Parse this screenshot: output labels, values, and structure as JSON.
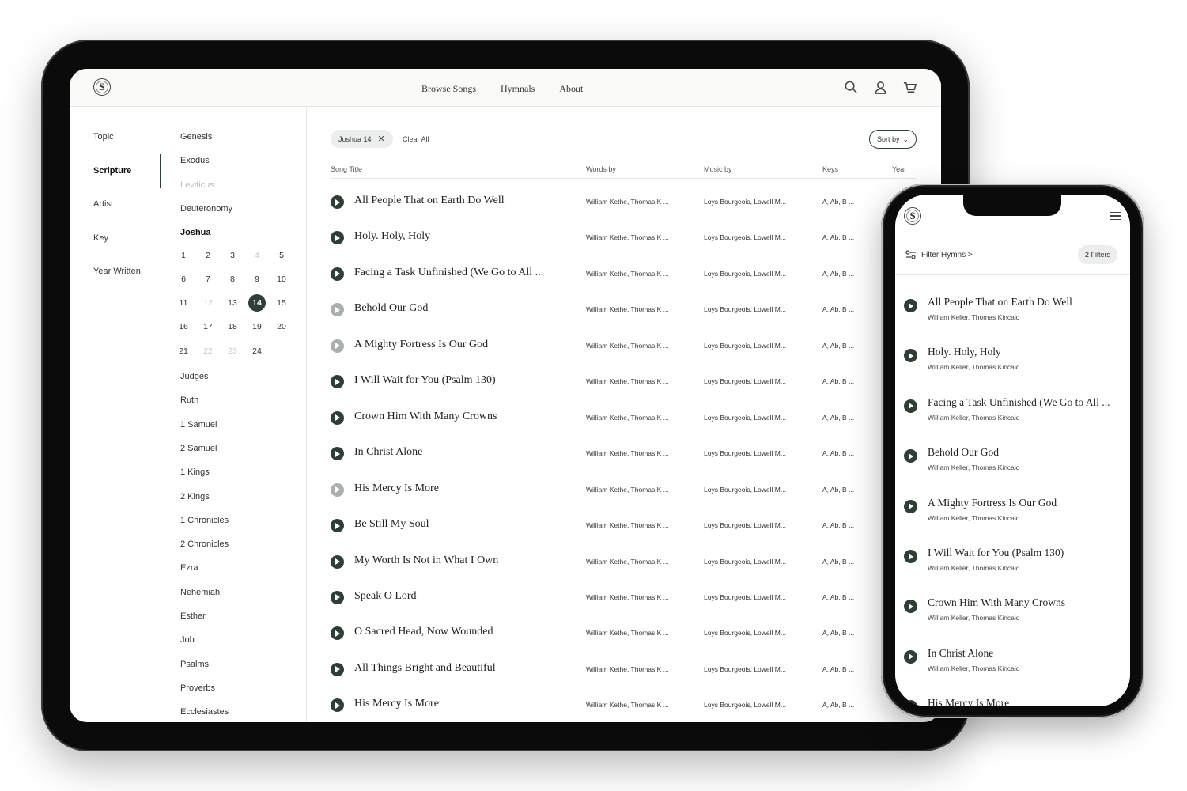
{
  "nav": {
    "browse": "Browse Songs",
    "hymnals": "Hymnals",
    "about": "About",
    "logo": "S"
  },
  "icons": [
    "search-icon",
    "user-icon",
    "cart-icon"
  ],
  "categories": [
    "Topic",
    "Scripture",
    "Artist",
    "Key",
    "Year Written"
  ],
  "active_category": "Scripture",
  "books_before": [
    "Genesis",
    "Exodus",
    "Leviticus",
    "Deuteronomy",
    "Joshua"
  ],
  "chapters": [
    "1",
    "2",
    "3",
    "4",
    "5",
    "6",
    "7",
    "8",
    "9",
    "10",
    "11",
    "12",
    "13",
    "14",
    "15",
    "16",
    "17",
    "18",
    "19",
    "20",
    "21",
    "22",
    "23",
    "24"
  ],
  "dim_chapters": [
    "4",
    "12",
    "22",
    "23"
  ],
  "selected_chapter": "14",
  "books_after": [
    "Judges",
    "Ruth",
    "1 Samuel",
    "2 Samuel",
    "1 Kings",
    "2 Kings",
    "1 Chronicles",
    "2 Chronicles",
    "Ezra",
    "Nehemiah",
    "Esther",
    "Job",
    "Psalms",
    "Proverbs",
    "Ecclesiastes"
  ],
  "filter": {
    "chip": "Joshua 14",
    "clear": "Clear All",
    "sort": "Sort by"
  },
  "columns": {
    "title": "Song Title",
    "words": "Words by",
    "music": "Music by",
    "keys": "Keys",
    "year": "Year"
  },
  "songs": [
    {
      "title": "All People That on Earth Do Well",
      "dim": false
    },
    {
      "title": "Holy. Holy, Holy",
      "dim": false
    },
    {
      "title": "Facing a Task Unfinished (We Go to All ...",
      "dim": false
    },
    {
      "title": "Behold Our God",
      "dim": true
    },
    {
      "title": "A Mighty Fortress Is Our God",
      "dim": true
    },
    {
      "title": "I Will Wait for You (Psalm 130)",
      "dim": false
    },
    {
      "title": "Crown Him With Many Crowns",
      "dim": false
    },
    {
      "title": "In Christ Alone",
      "dim": false
    },
    {
      "title": "His Mercy Is More",
      "dim": true
    },
    {
      "title": "Be Still My Soul",
      "dim": false
    },
    {
      "title": "My Worth Is Not in What I Own",
      "dim": false
    },
    {
      "title": "Speak O Lord",
      "dim": false
    },
    {
      "title": "O Sacred Head, Now Wounded",
      "dim": false
    },
    {
      "title": "All Things Bright and Beautiful",
      "dim": false
    },
    {
      "title": "His Mercy Is More",
      "dim": false
    }
  ],
  "song_words": "William Kethe, Thomas K ...",
  "song_music": "Loys Bourgeois, Lowell M...",
  "song_keys": "A, Ab, B ...",
  "mobile": {
    "filter_label": "Filter Hymns >",
    "filter_count": "2 Filters",
    "author": "William Keller, Thomas Kincaid",
    "songs": [
      "All People That on Earth Do Well",
      "Holy. Holy, Holy",
      "Facing a Task Unfinished (We Go to All ...",
      "Behold Our God",
      "A Mighty Fortress Is Our God",
      "I Will Wait for You (Psalm 130)",
      "Crown Him With Many Crowns",
      "In Christ Alone",
      "His Mercy Is More"
    ]
  },
  "colors": {
    "accent": "#2e3f36",
    "dim": "#aab0ad",
    "chip": "#eceeed"
  }
}
